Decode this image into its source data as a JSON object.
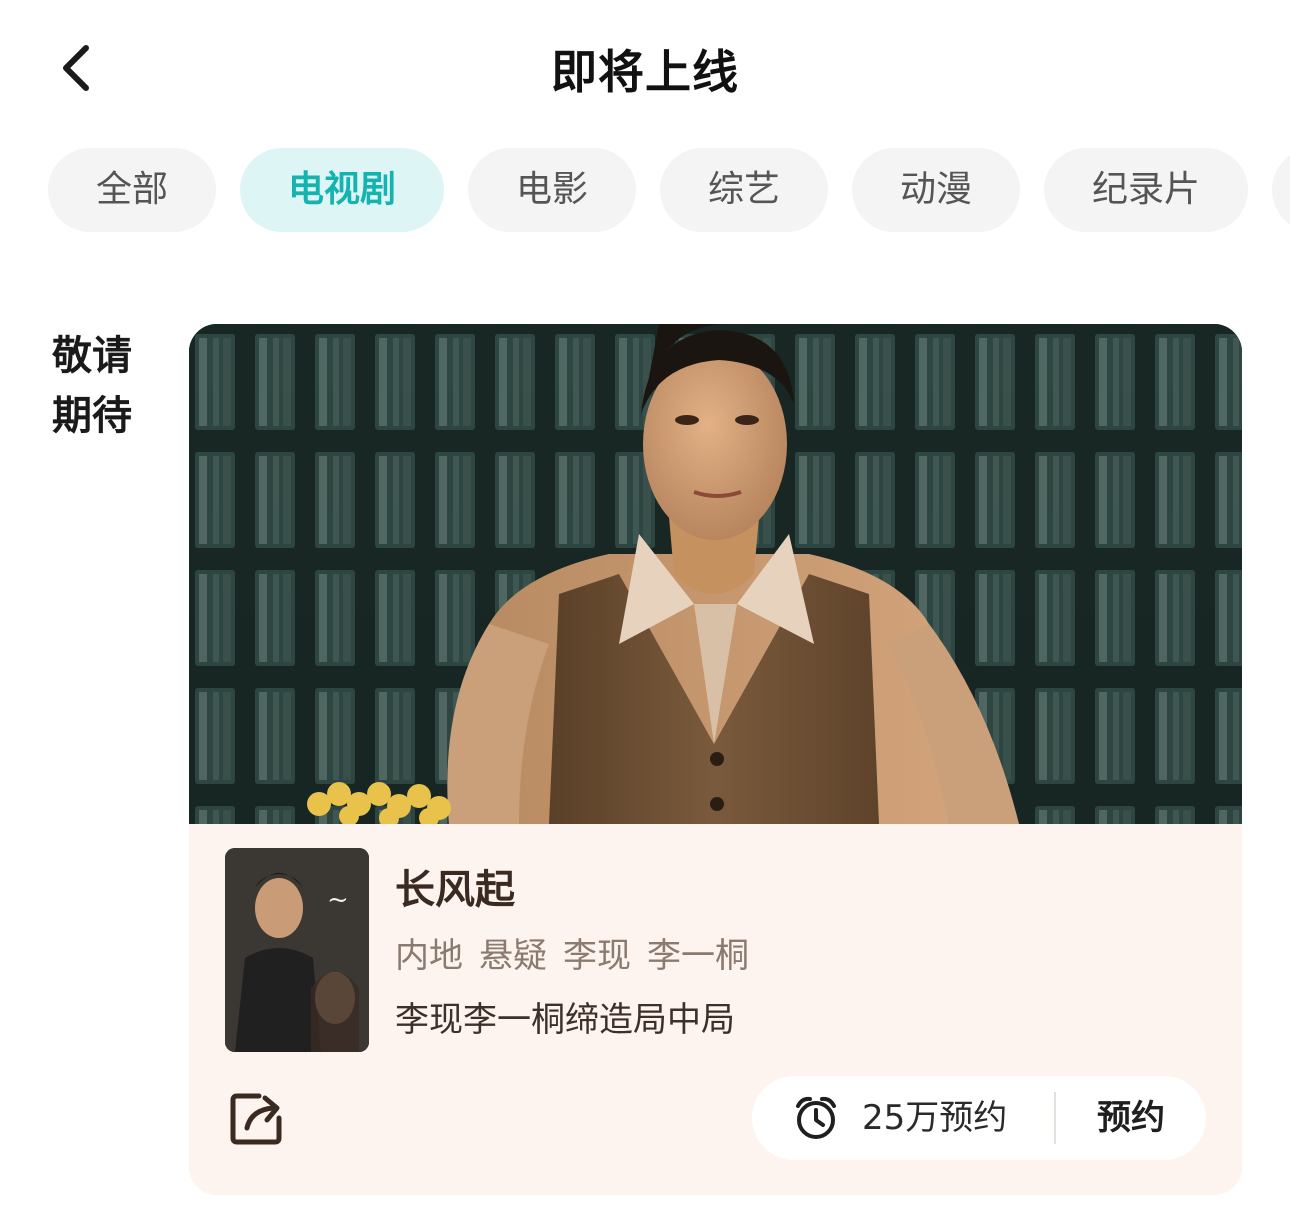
{
  "header": {
    "title": "即将上线",
    "back_icon": "chevron-left-icon"
  },
  "tabs": [
    {
      "label": "全部",
      "active": false
    },
    {
      "label": "电视剧",
      "active": true
    },
    {
      "label": "电影",
      "active": false
    },
    {
      "label": "综艺",
      "active": false
    },
    {
      "label": "动漫",
      "active": false
    },
    {
      "label": "纪录片",
      "active": false
    }
  ],
  "section": {
    "label_line1": "敬请",
    "label_line2": "期待"
  },
  "card": {
    "title": "长风起",
    "tags": [
      "内地",
      "悬疑",
      "李现",
      "李一桐"
    ],
    "description": "李现李一桐缔造局中局",
    "reserve_count": "25万预约",
    "reserve_label": "预约",
    "share_icon": "share-icon",
    "clock_icon": "alarm-clock-icon"
  },
  "colors": {
    "accent": "#14b3b0",
    "active_tab_bg": "#ddf6f5",
    "tab_bg": "#f4f4f4",
    "card_bg": "#fdf4ef"
  }
}
